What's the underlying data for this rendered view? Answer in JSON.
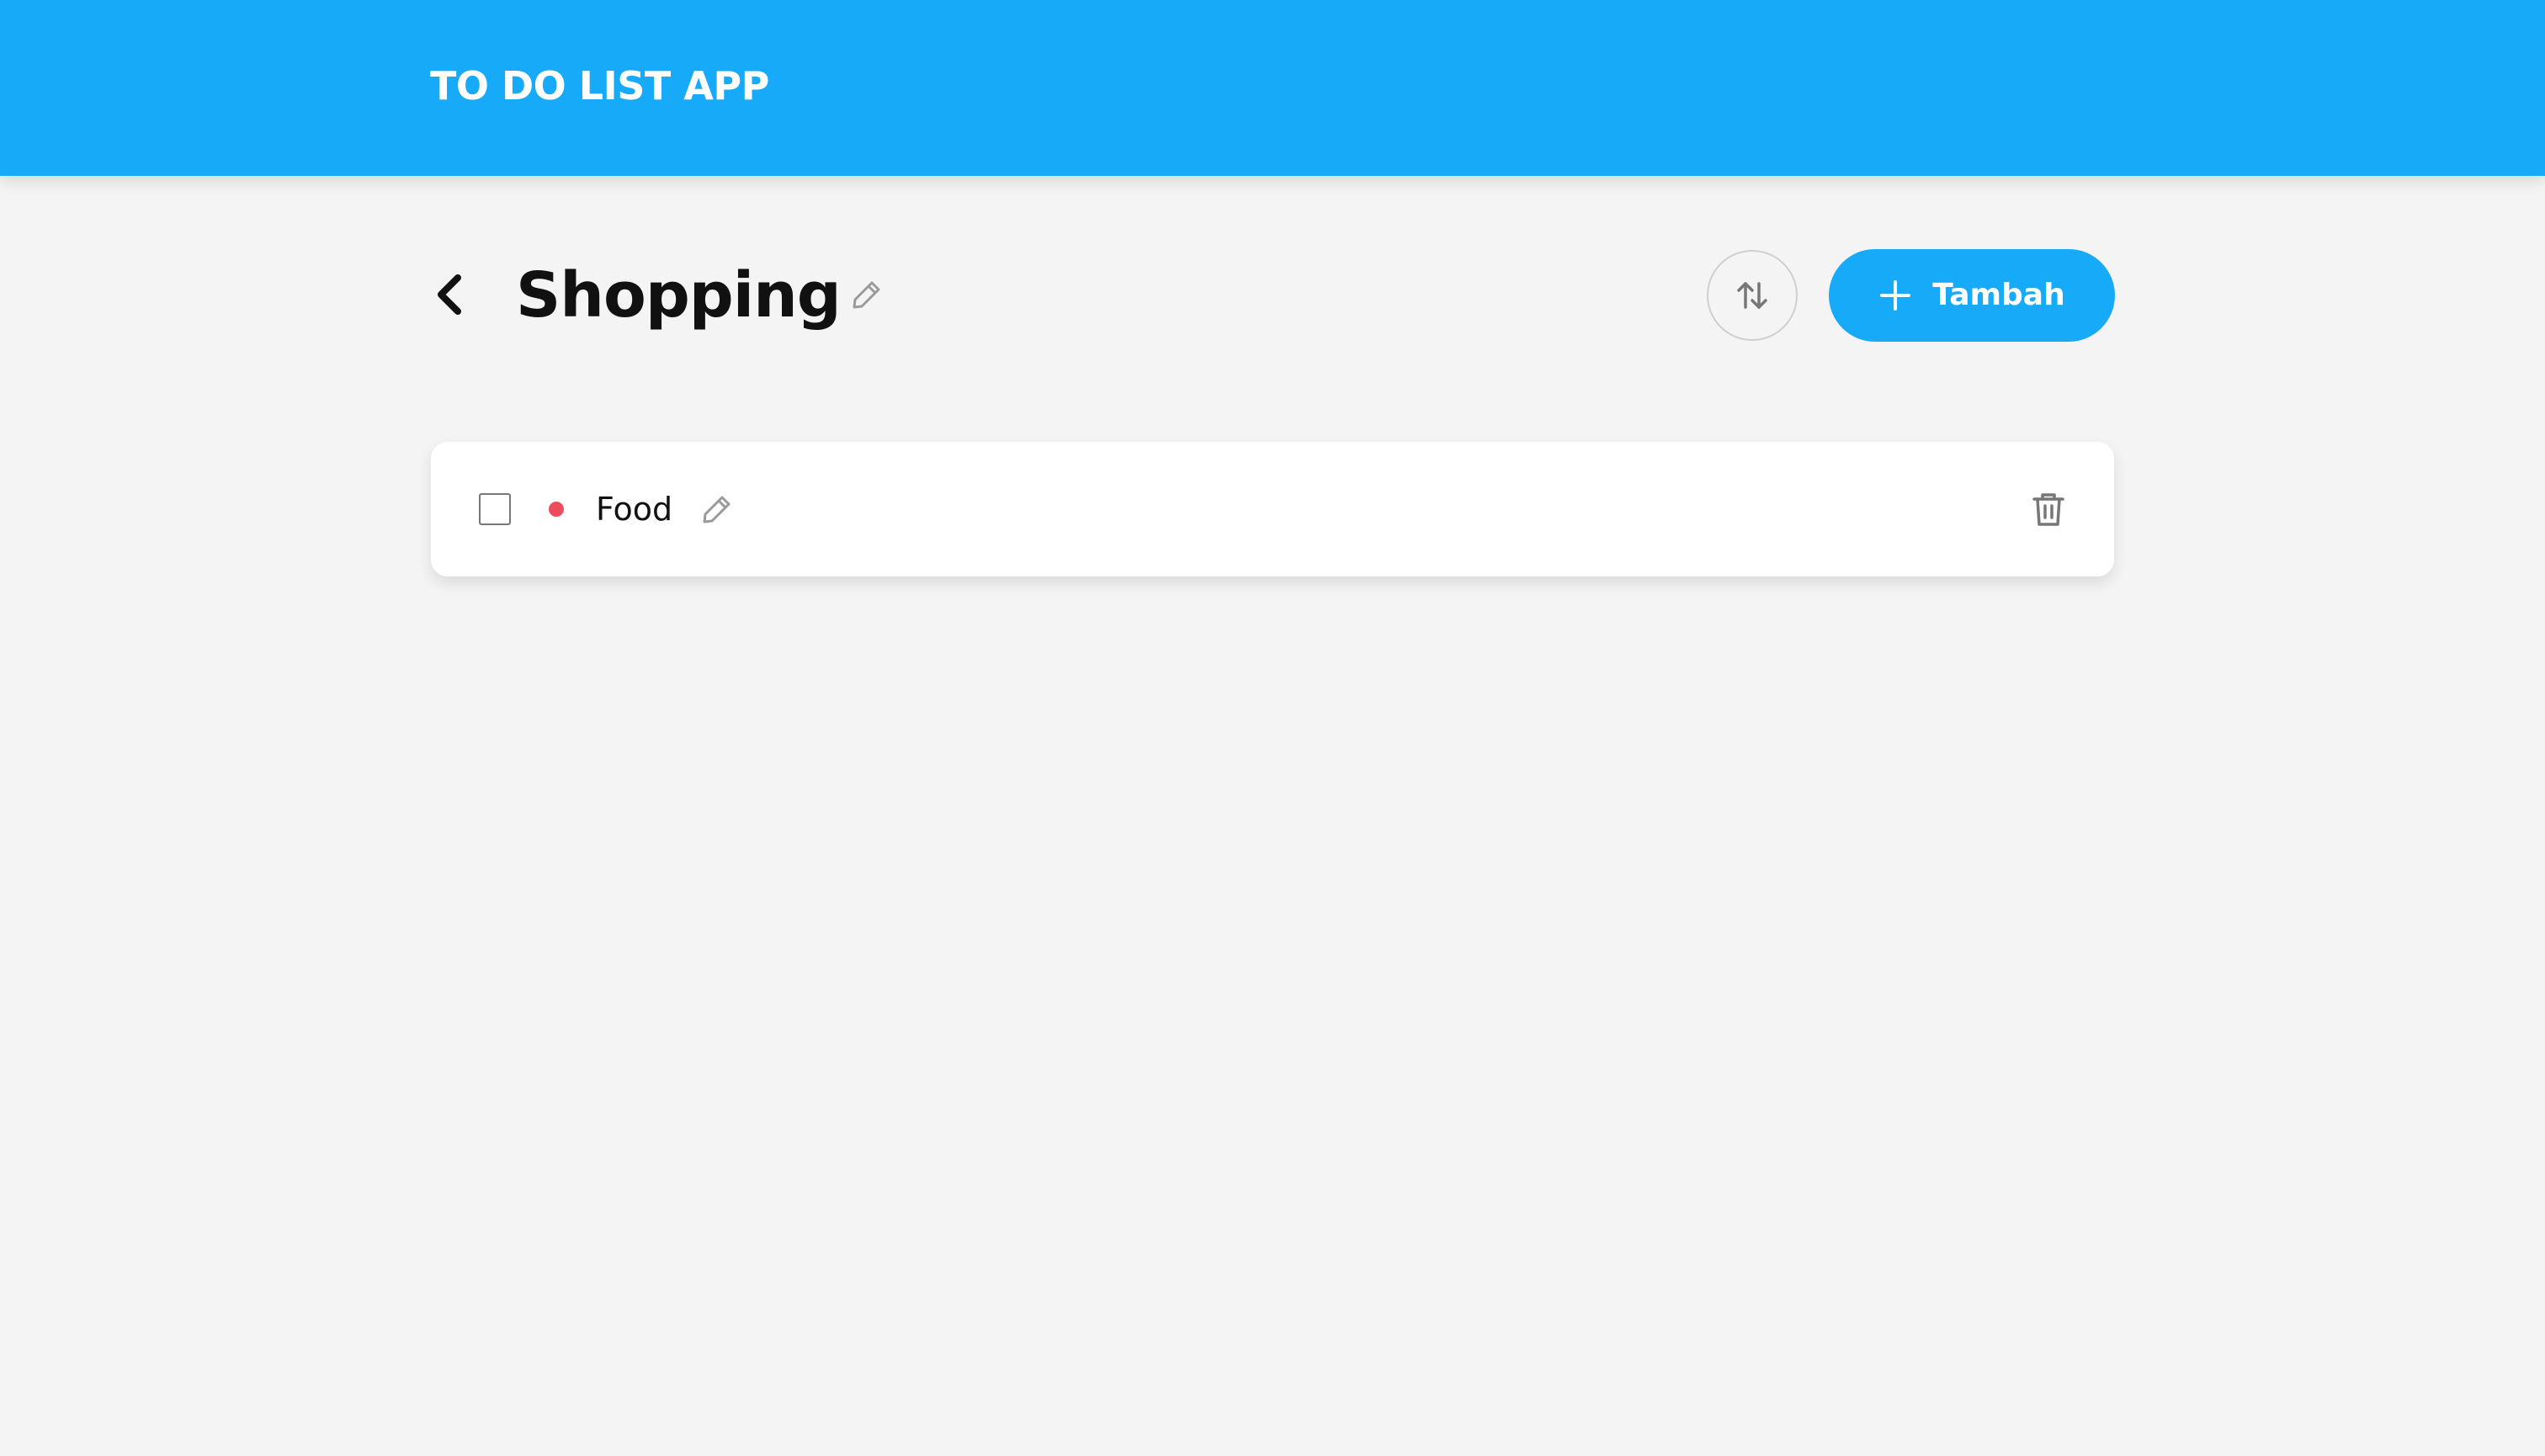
{
  "header": {
    "title": "TO DO LIST APP",
    "bg_color": "#16aaf8"
  },
  "page": {
    "title": "Shopping",
    "back_icon": "chevron-left-icon",
    "edit_icon": "pencil-icon"
  },
  "toolbar": {
    "sort_icon": "sort-arrows-icon",
    "add_label": "Tambah",
    "add_icon": "plus-icon",
    "accent_color": "#16aaf8"
  },
  "items": [
    {
      "name": "Food",
      "checked": false,
      "priority_color": "#ed4c5c",
      "edit_icon": "pencil-icon",
      "delete_icon": "trash-icon"
    }
  ]
}
